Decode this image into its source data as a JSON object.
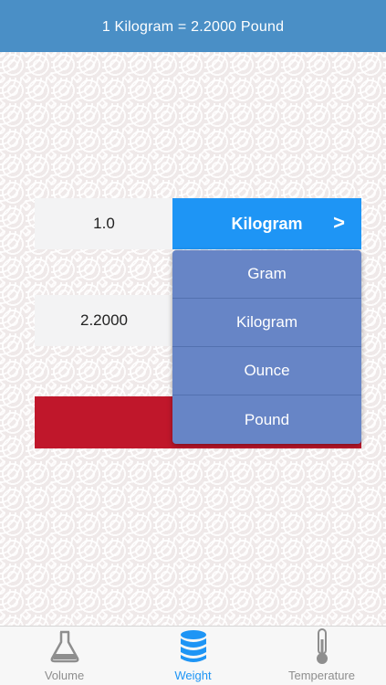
{
  "header": {
    "conversion_text": "1 Kilogram = 2.2000 Pound"
  },
  "converter": {
    "input_value": "1.0",
    "output_value": "2.2000",
    "selected_unit": "Kilogram",
    "arrow": ">"
  },
  "dropdown": {
    "options": [
      "Gram",
      "Kilogram",
      "Ounce",
      "Pound"
    ]
  },
  "tabs": [
    {
      "label": "Volume",
      "icon": "flask-icon",
      "active": false
    },
    {
      "label": "Weight",
      "icon": "database-stack-icon",
      "active": true
    },
    {
      "label": "Temperature",
      "icon": "thermometer-icon",
      "active": false
    }
  ],
  "colors": {
    "header": "#4a8fc6",
    "accent": "#1e95f5",
    "dropdown": "#6785c6",
    "red_bar": "#c0172b",
    "inactive_tab": "#8e8e8e"
  }
}
